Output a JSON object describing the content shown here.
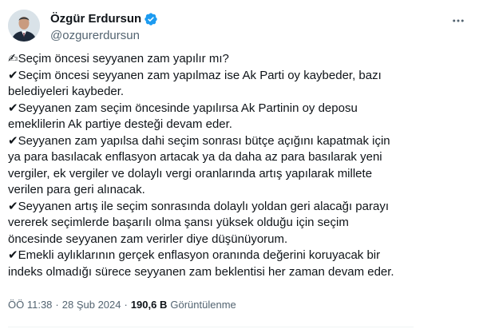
{
  "author": {
    "display_name": "Özgür Erdursun",
    "handle": "@ozgurerdursun"
  },
  "icons": {
    "verified": "verified-badge-icon",
    "more": "more-horizontal-icon",
    "writing_hand": "✍",
    "check_mark": "✔"
  },
  "colors": {
    "text": "#0f1419",
    "secondary": "#536471",
    "verified": "#1d9bf0"
  },
  "tweet": {
    "lines": [
      "✍Seçim öncesi seyyanen zam yapılır mı?",
      "✔Seçim öncesi seyyanen zam yapılmaz ise Ak Parti oy kaybeder, bazı",
      "belediyeleri kaybeder.",
      "✔Seyyanen zam seçim öncesinde yapılırsa Ak Partinin oy deposu",
      "emeklilerin Ak partiye desteği devam eder.",
      "✔Seyyanen zam yapılsa dahi seçim sonrası bütçe açığını kapatmak için",
      "ya para basılacak enflasyon artacak ya da daha az para basılarak yeni",
      "vergiler, ek vergiler ve dolaylı vergi oranlarında artış yapılarak millete",
      "verilen para geri alınacak.",
      "✔Seyyanen artış ile seçim sonrasında dolaylı yoldan geri alacağı parayı",
      "vererek seçimlerde başarılı olma şansı yüksek olduğu için seçim",
      "öncesinde seyyanen zam verirler diye düşünüyorum.",
      "✔Emekli aylıklarının gerçek enflasyon oranında değerini koruyacak bir",
      "indeks olmadığı sürece seyyanen zam beklentisi her zaman devam eder."
    ]
  },
  "meta": {
    "time": "ÖÖ 11:38",
    "separator": "·",
    "date": "28 Şub 2024",
    "views_count": "190,6 B",
    "views_label": "Görüntülenme"
  }
}
